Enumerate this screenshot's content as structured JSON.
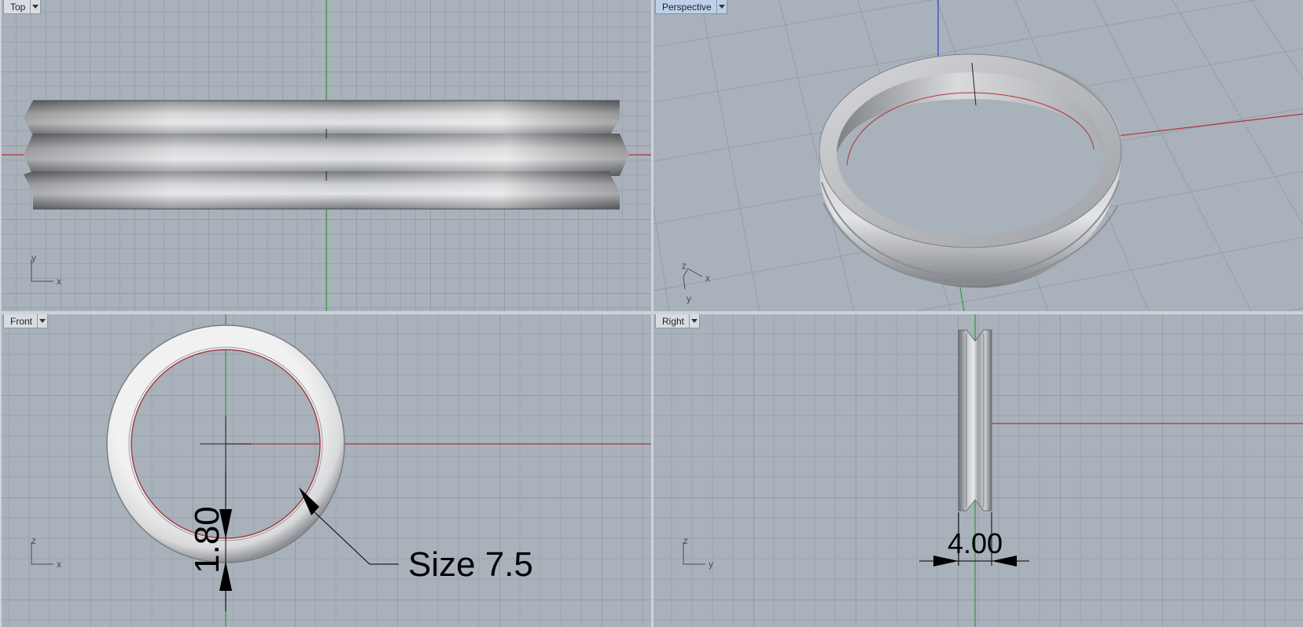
{
  "viewports": {
    "top": {
      "label": "Top",
      "axis_a": "y",
      "axis_b": "x"
    },
    "perspective": {
      "label": "Perspective",
      "axis_a": "z",
      "axis_b": "x",
      "axis_c": "y"
    },
    "front": {
      "label": "Front",
      "axis_a": "z",
      "axis_b": "x"
    },
    "right": {
      "label": "Right",
      "axis_a": "z",
      "axis_b": "y"
    }
  },
  "annotations": {
    "thickness": "1.80",
    "ring_size": "Size 7.5",
    "width": "4.00"
  },
  "colors": {
    "viewport_bg": "#a9b1bb",
    "grid_minor": "#9aa2ad",
    "grid_major": "#858d98",
    "x_axis": "#b0343a",
    "y_axis": "#2c9a37",
    "z_axis": "#3344c8",
    "active_tab": "#bcd0ea"
  }
}
